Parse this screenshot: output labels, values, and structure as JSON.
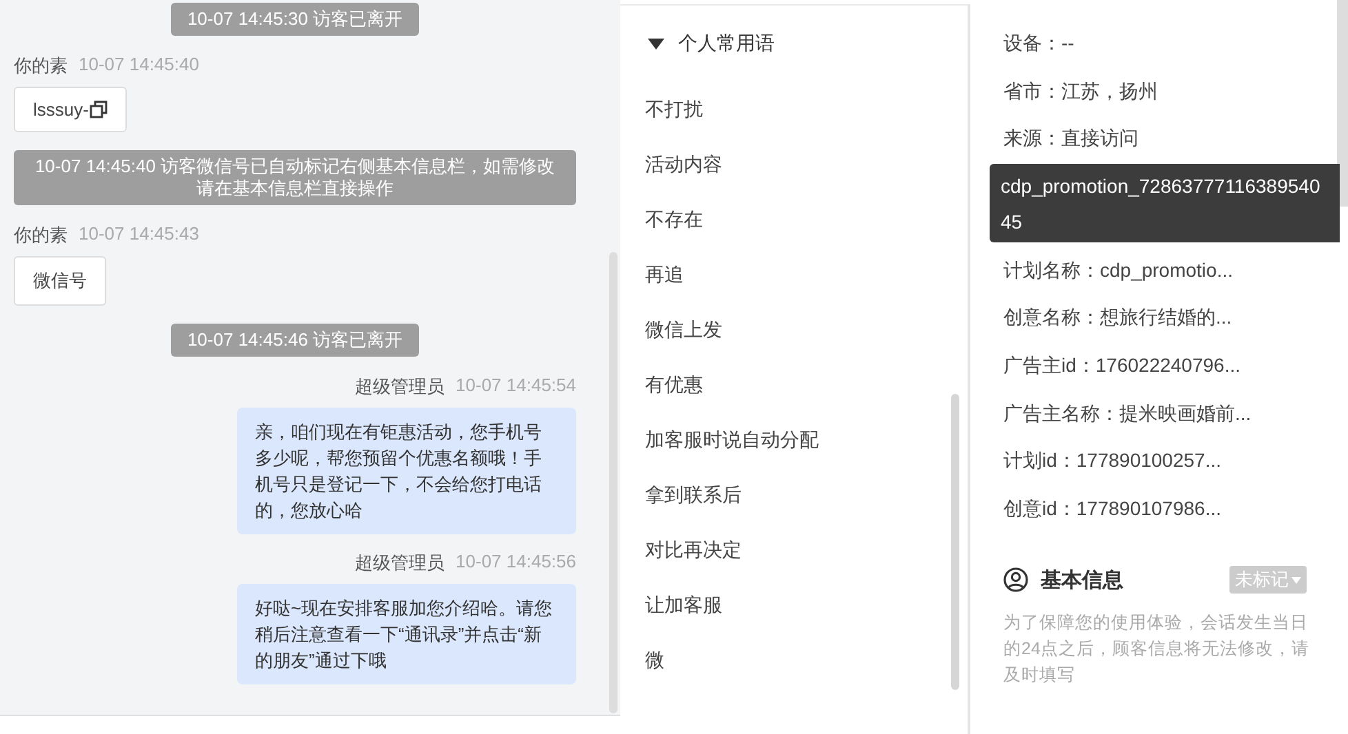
{
  "chat": {
    "messages": [
      {
        "kind": "system",
        "text": "10-07 14:45:30 访客已离开"
      },
      {
        "kind": "visitor",
        "sender": "你的素",
        "time": "10-07 14:45:40",
        "text": "lsssuy-",
        "copy_icon": true
      },
      {
        "kind": "system",
        "text": "10-07 14:45:40 访客微信号已自动标记右侧基本信息栏，如需修改请在基本信息栏直接操作"
      },
      {
        "kind": "visitor",
        "sender": "你的素",
        "time": "10-07 14:45:43",
        "text": "微信号",
        "copy_icon": false
      },
      {
        "kind": "system",
        "text": "10-07 14:45:46 访客已离开"
      },
      {
        "kind": "agent",
        "sender": "超级管理员",
        "time": "10-07 14:45:54",
        "text": "亲，咱们现在有钜惠活动，您手机号多少呢，帮您预留个优惠名额哦！手机号只是登记一下，不会给您打电话的，您放心哈"
      },
      {
        "kind": "agent",
        "sender": "超级管理员",
        "time": "10-07 14:45:56",
        "text": "好哒~现在安排客服加您介绍哈。请您稍后注意查看一下“通讯录”并点击“新的朋友”通过下哦"
      }
    ]
  },
  "phrases": {
    "group": {
      "label": "个人常用语",
      "expanded": true
    },
    "items": [
      "不打扰",
      "活动内容",
      "不存在",
      "再追",
      "微信上发",
      "有优惠",
      "加客服时说自动分配",
      "拿到联系后",
      "对比再决定",
      "让加客服",
      "微"
    ]
  },
  "info": {
    "fields_top": [
      "设备：--",
      "省市：江苏，扬州",
      "来源：直接访问"
    ],
    "tooltip": "cdp_promotion_7286377711638954045",
    "fields_bottom": [
      "计划名称：cdp_promotio...",
      "创意名称：想旅行结婚的...",
      "广告主id：176022240796...",
      "广告主名称：提米映画婚前...",
      "计划id：177890100257...",
      "创意id：177890107986..."
    ],
    "section": {
      "title": "基本信息",
      "tag": "未标记",
      "note": "为了保障您的使用体验，会话发生当日的24点之后，顾客信息将无法修改，请及时填写"
    }
  }
}
